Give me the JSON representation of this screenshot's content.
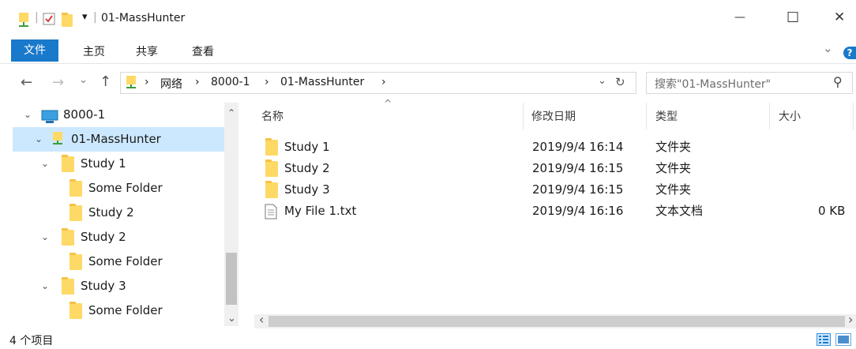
{
  "window": {
    "title": "01-MassHunter",
    "minimize_glyph": "—",
    "maximize_glyph": "☐",
    "close_glyph": "✕",
    "qa_separator": "|",
    "qa_dropdown": "▾"
  },
  "ribbon": {
    "file": "文件",
    "tabs": [
      "主页",
      "共享",
      "查看"
    ],
    "expand_glyph": "⌄",
    "help_glyph": "?"
  },
  "nav": {
    "back": "←",
    "forward": "→",
    "recent": "⌄",
    "up": "↑"
  },
  "address": {
    "sep": "›",
    "crumbs": [
      "网络",
      "8000-1",
      "01-MassHunter"
    ],
    "dropdown": "⌄",
    "refresh": "↻"
  },
  "search": {
    "placeholder": "搜索\"01-MassHunter\"",
    "icon": "⚲"
  },
  "tree": {
    "expanded": "⌄",
    "items": [
      {
        "label": "8000-1",
        "icon": "computer-icon"
      },
      {
        "label": "01-MassHunter",
        "icon": "network-folder-icon",
        "selected": true
      },
      {
        "label": "Study 1",
        "icon": "folder-icon"
      },
      {
        "label": "Some Folder",
        "icon": "folder-icon"
      },
      {
        "label": "Study 2",
        "icon": "folder-icon"
      },
      {
        "label": "Study 2",
        "icon": "folder-icon"
      },
      {
        "label": "Some Folder",
        "icon": "folder-icon"
      },
      {
        "label": "Study 3",
        "icon": "folder-icon"
      },
      {
        "label": "Some Folder",
        "icon": "folder-icon"
      }
    ]
  },
  "columns": {
    "name": "名称",
    "modified": "修改日期",
    "type": "类型",
    "size": "大小",
    "sort_glyph": "^"
  },
  "files": [
    {
      "name": "Study 1",
      "modified": "2019/9/4 16:14",
      "type": "文件夹",
      "size": "",
      "icon": "folder-icon"
    },
    {
      "name": "Study 2",
      "modified": "2019/9/4 16:15",
      "type": "文件夹",
      "size": "",
      "icon": "folder-icon"
    },
    {
      "name": "Study 3",
      "modified": "2019/9/4 16:15",
      "type": "文件夹",
      "size": "",
      "icon": "folder-icon"
    },
    {
      "name": "My File 1.txt",
      "modified": "2019/9/4 16:16",
      "type": "文本文档",
      "size": "0 KB",
      "icon": "text-file-icon"
    }
  ],
  "scroll": {
    "up": "⌃",
    "down": "⌄",
    "left": "‹",
    "right": "›"
  },
  "status": {
    "count": "4 个项目"
  }
}
